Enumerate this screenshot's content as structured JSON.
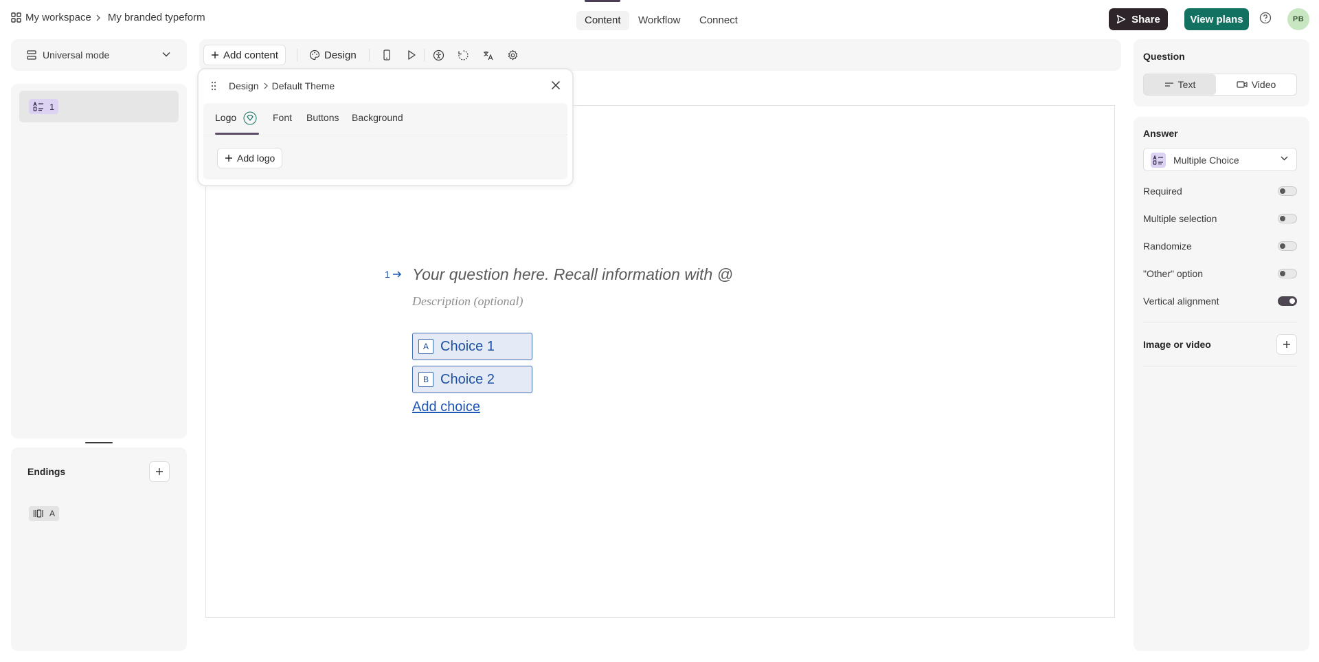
{
  "breadcrumb": {
    "workspace": "My workspace",
    "form": "My branded typeform"
  },
  "nav": {
    "tabs": [
      {
        "label": "Content",
        "active": true
      },
      {
        "label": "Workflow"
      },
      {
        "label": "Connect"
      }
    ]
  },
  "header": {
    "share_label": "Share",
    "plans_label": "View plans",
    "avatar_initials": "PB"
  },
  "left": {
    "mode_label": "Universal mode",
    "question_number": "1",
    "endings_title": "Endings",
    "ending_label": "A"
  },
  "toolbar": {
    "add_content": "Add content",
    "design": "Design"
  },
  "design_popup": {
    "crumb_parent": "Design",
    "crumb_current": "Default Theme",
    "tabs": [
      "Logo",
      "Font",
      "Buttons",
      "Background"
    ],
    "add_logo": "Add logo"
  },
  "question": {
    "number": "1",
    "title_placeholder": "Your question here. Recall information with @",
    "description_placeholder": "Description (optional)",
    "choices": [
      {
        "key": "A",
        "label": "Choice 1"
      },
      {
        "key": "B",
        "label": "Choice 2"
      }
    ],
    "add_choice": "Add choice"
  },
  "right": {
    "question_title": "Question",
    "question_types": [
      "Text",
      "Video"
    ],
    "answer_title": "Answer",
    "answer_type": "Multiple Choice",
    "options": [
      {
        "label": "Required",
        "on": false
      },
      {
        "label": "Multiple selection",
        "on": false
      },
      {
        "label": "Randomize",
        "on": false
      },
      {
        "label": "\"Other\" option",
        "on": false
      },
      {
        "label": "Vertical alignment",
        "on": true
      }
    ],
    "media_title": "Image or video"
  },
  "colors": {
    "share_bg": "#2d2529",
    "plans_bg": "#137162",
    "choice_accent": "#3e6db6",
    "question_badge": "#dcd3f2"
  }
}
